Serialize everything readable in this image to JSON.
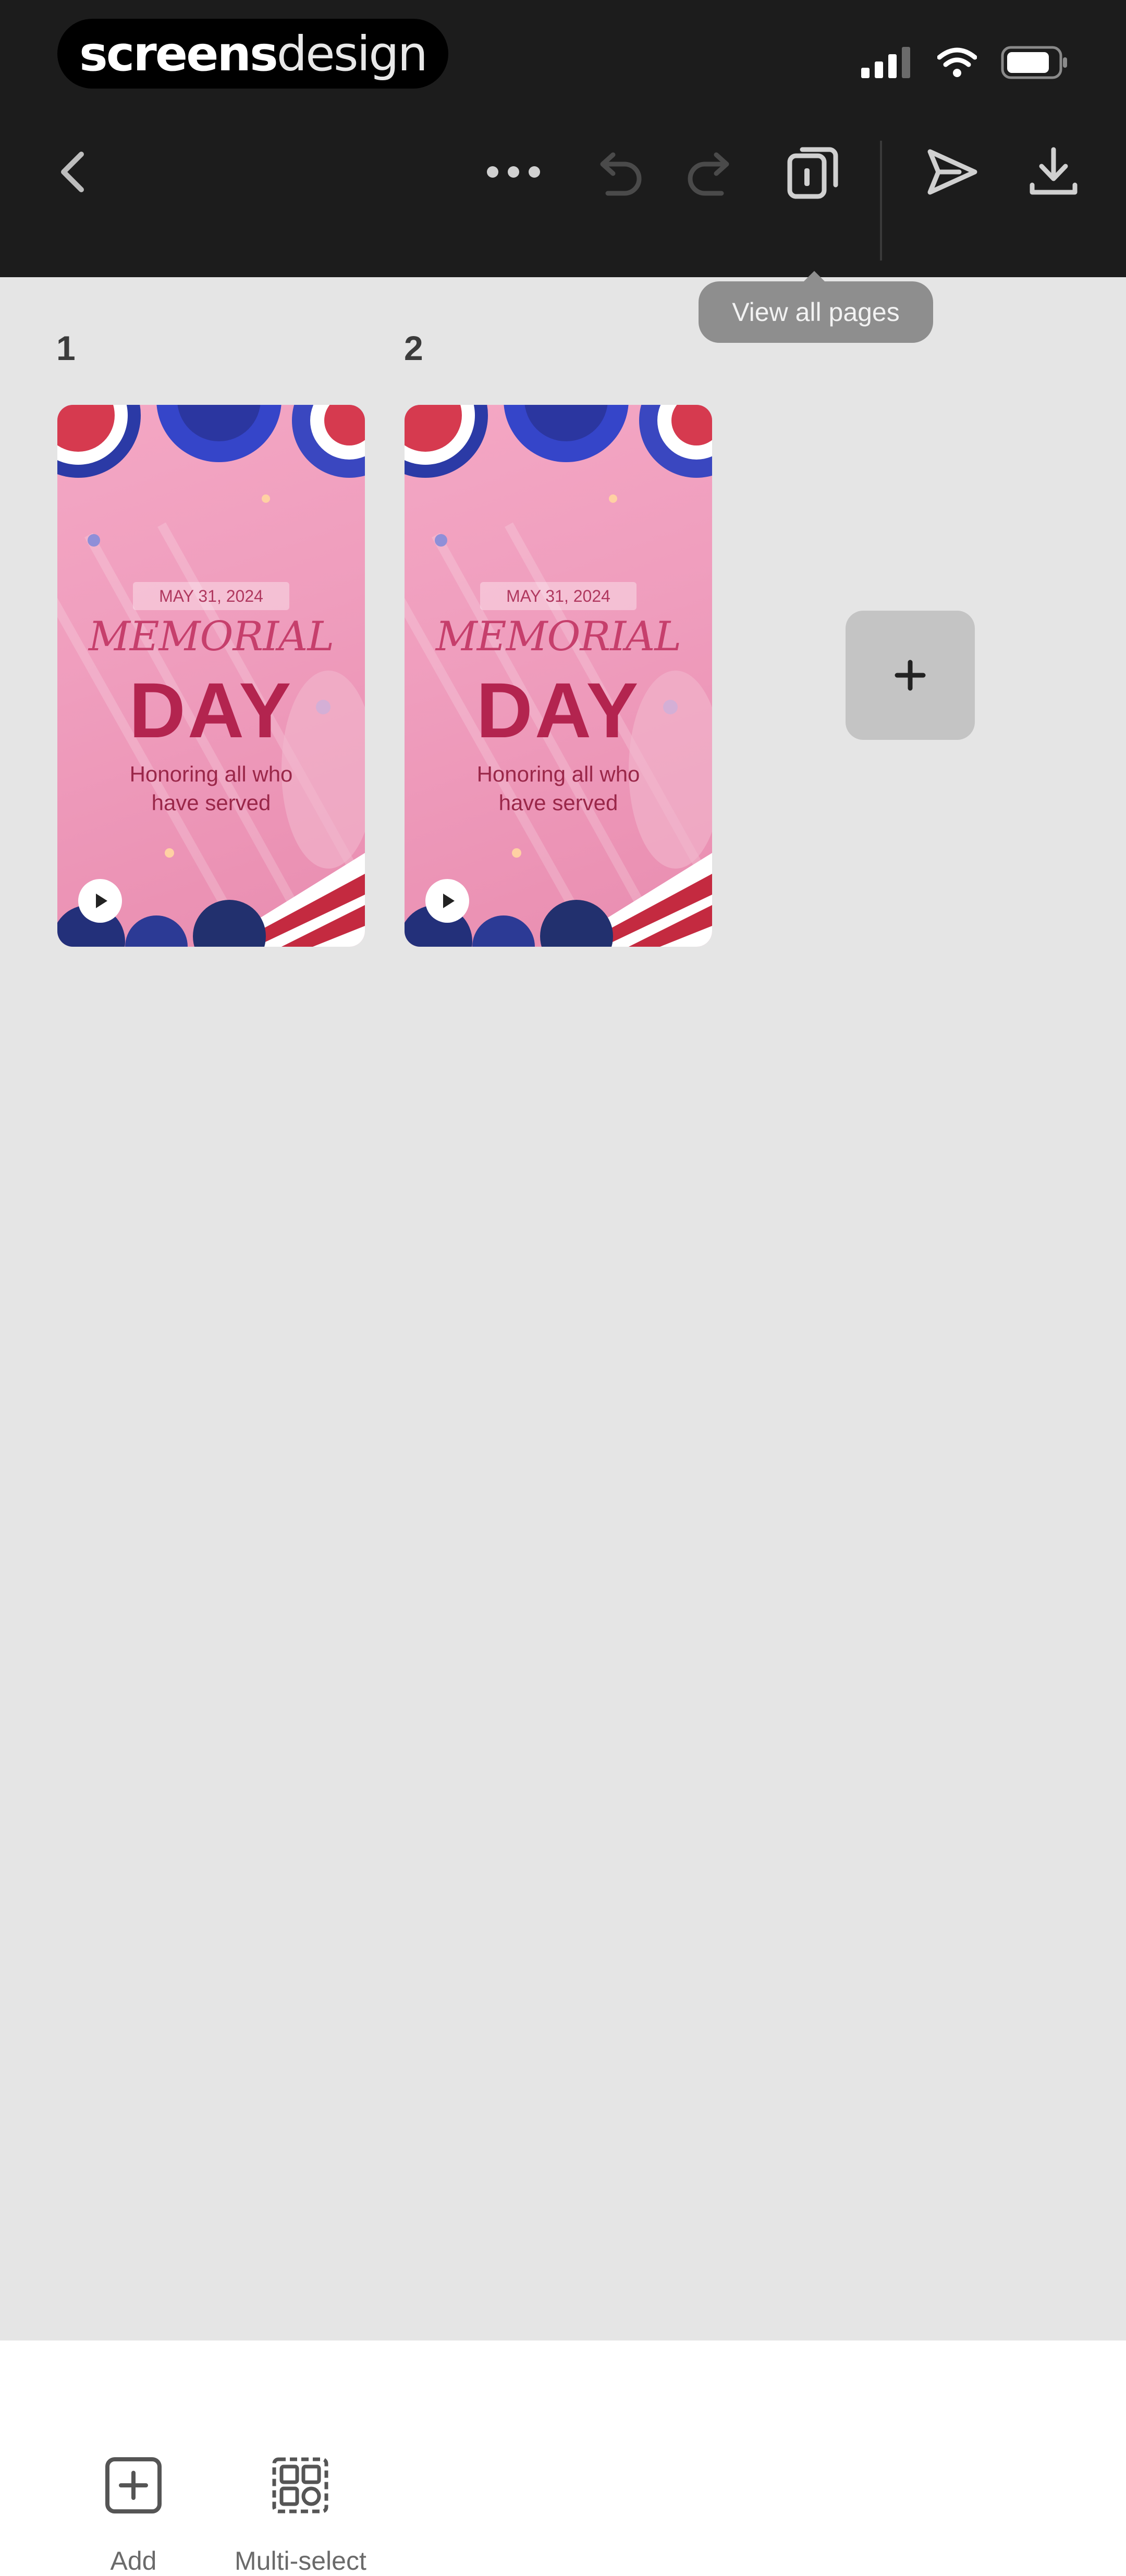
{
  "status_bar": {
    "brand_bold": "screens",
    "brand_light": "design"
  },
  "toolbar": {
    "back_icon": "chevron-left-icon",
    "more_icon": "more-dots-icon",
    "undo_icon": "undo-icon",
    "redo_icon": "redo-icon",
    "pages_icon": "pages-icon",
    "share_icon": "send-icon",
    "download_icon": "download-icon",
    "tooltip": "View all pages"
  },
  "pages": [
    {
      "number": "1",
      "date": "MAY 31, 2024",
      "title_top": "MEMORIAL",
      "title_main": "DAY",
      "subtitle_line1": "Honoring all who",
      "subtitle_line2": "have served"
    },
    {
      "number": "2",
      "date": "MAY 31, 2024",
      "title_top": "MEMORIAL",
      "title_main": "DAY",
      "subtitle_line1": "Honoring all who",
      "subtitle_line2": "have served"
    }
  ],
  "actions": {
    "add_label": "Add",
    "multiselect_label": "Multi-select"
  },
  "colors": {
    "toolbar_bg": "#1c1c1c",
    "canvas_bg": "#e5e5e5",
    "accent_pink": "#ef9dbd",
    "title_red": "#b3244f"
  }
}
